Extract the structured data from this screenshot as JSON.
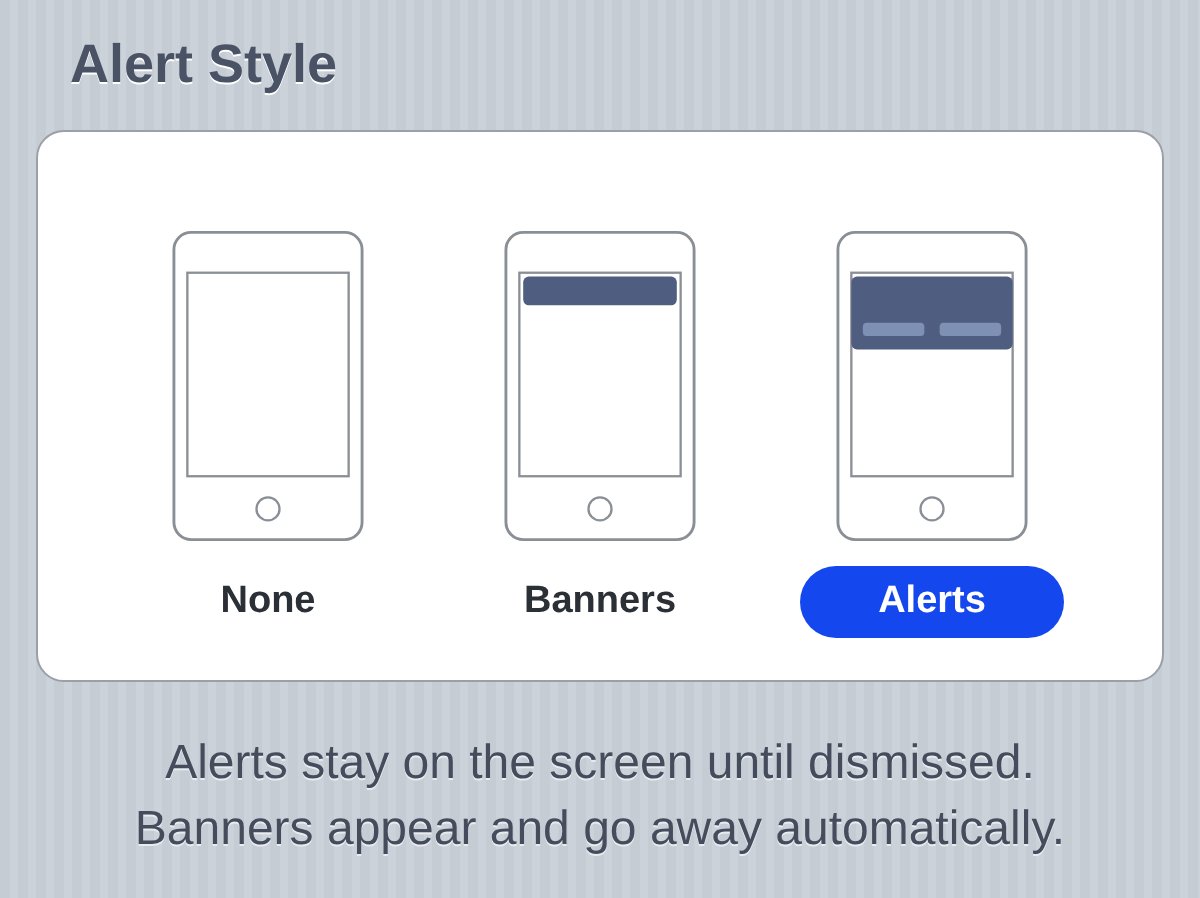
{
  "section_title": "Alert Style",
  "options": [
    {
      "label": "None",
      "kind": "none",
      "selected": false
    },
    {
      "label": "Banners",
      "kind": "banners",
      "selected": false
    },
    {
      "label": "Alerts",
      "kind": "alerts",
      "selected": true
    }
  ],
  "footer": [
    "Alerts stay on the screen until dismissed.",
    "Banners appear and go away automatically."
  ]
}
